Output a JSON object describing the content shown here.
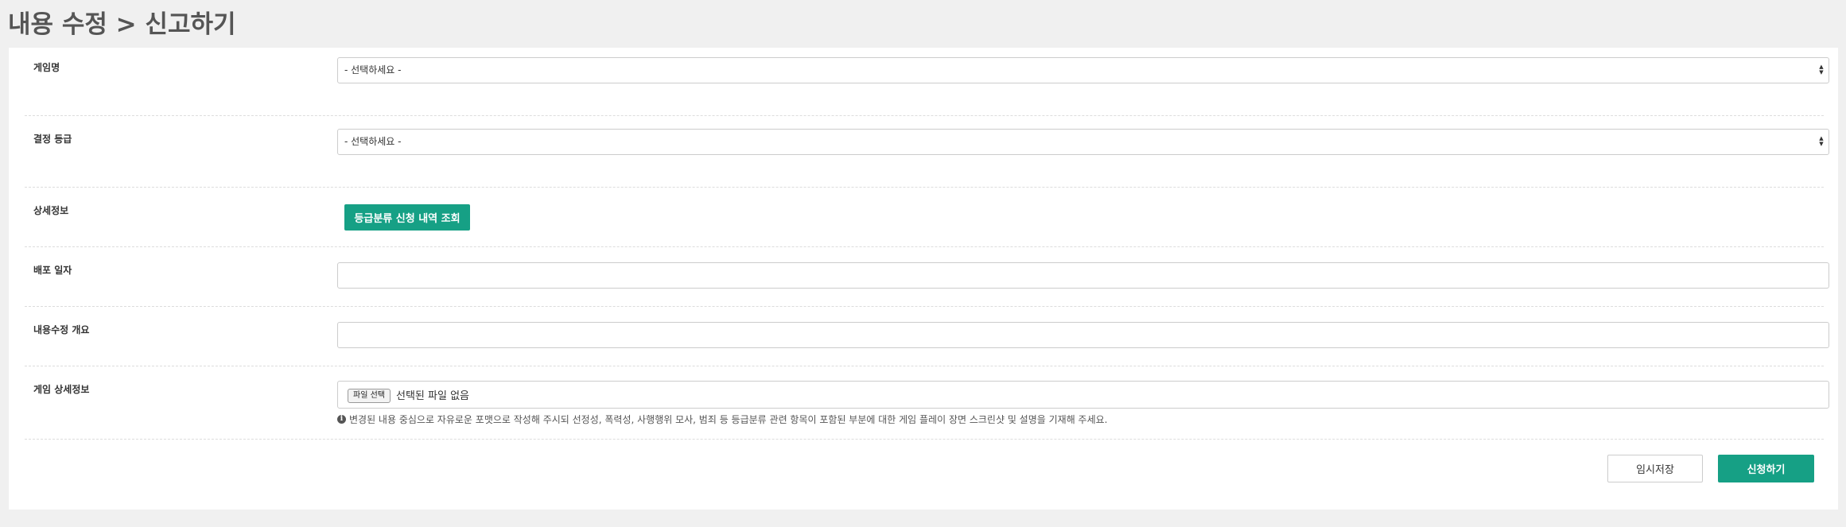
{
  "page": {
    "title": "내용 수정 > 신고하기"
  },
  "form": {
    "game_name": {
      "label": "게임명",
      "selected": "- 선택하세요 -"
    },
    "decision_grade": {
      "label": "결정 등급",
      "selected": "- 선택하세요 -"
    },
    "details": {
      "label": "상세정보",
      "button_label": "등급분류 신청 내역 조회"
    },
    "distribution_date": {
      "label": "배포 일자",
      "value": ""
    },
    "summary": {
      "label": "내용수정 개요",
      "value": ""
    },
    "game_details": {
      "label": "게임 상세정보",
      "file_button_label": "파일 선택",
      "file_status": "선택된 파일 없음",
      "help_text": "변경된 내용 중심으로 자유로운 포맷으로 작성해 주시되 선정성, 폭력성, 사행행위 모사, 범죄 등 등급분류 관련 항목이 포함된 부분에 대한 게임 플레이 장면 스크린샷 및 설명을 기재해 주세요."
    }
  },
  "actions": {
    "save_label": "임시저장",
    "submit_label": "신청하기"
  },
  "colors": {
    "accent": "#16a085",
    "background": "#f0f0f0",
    "panel": "#ffffff"
  },
  "icons": {
    "select_arrows": "select-arrows-icon",
    "info": "info-circle-icon"
  }
}
